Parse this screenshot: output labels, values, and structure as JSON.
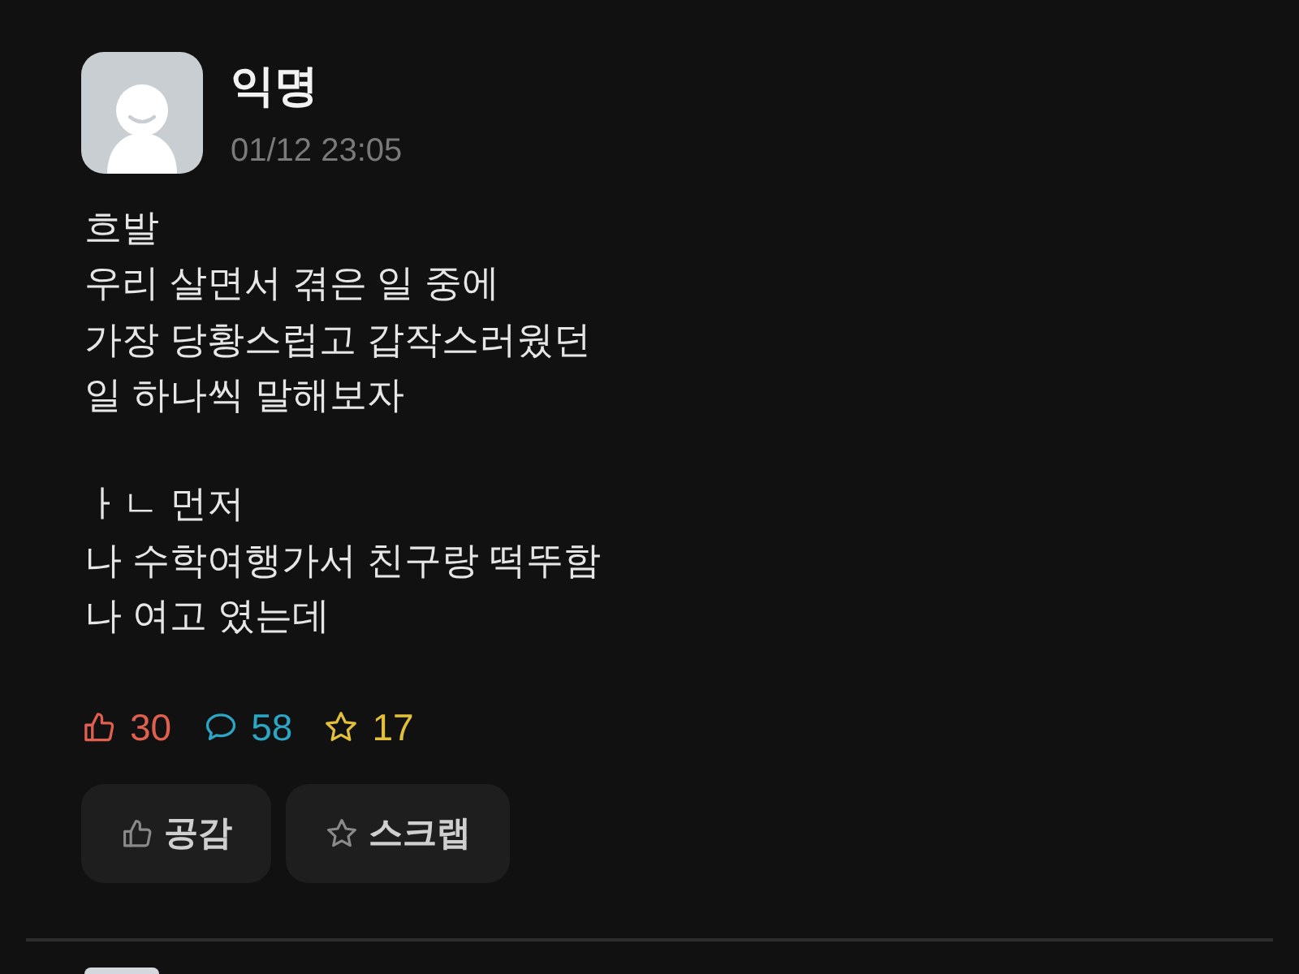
{
  "post": {
    "author": "익명",
    "time": "01/12 23:05",
    "paragraphs": [
      {
        "lines": [
          "흐발",
          "우리 살면서 겪은 일 중에",
          "가장 당황스럽고 갑작스러웠던",
          "일 하나씩 말해보자"
        ]
      },
      {
        "lines": [
          "ㅏㄴ 먼저",
          "나 수학여행가서 친구랑 떡뚜함",
          "나 여고 였는데"
        ]
      }
    ],
    "stats": [
      {
        "kind": "like",
        "count": "30",
        "color": "#e0604f"
      },
      {
        "kind": "comment",
        "count": "58",
        "color": "#2ba6c4"
      },
      {
        "kind": "scrap",
        "count": "17",
        "color": "#e3c03b"
      }
    ],
    "buttons": [
      {
        "kind": "like",
        "label": "공감"
      },
      {
        "kind": "scrap",
        "label": "스크랩"
      }
    ]
  }
}
